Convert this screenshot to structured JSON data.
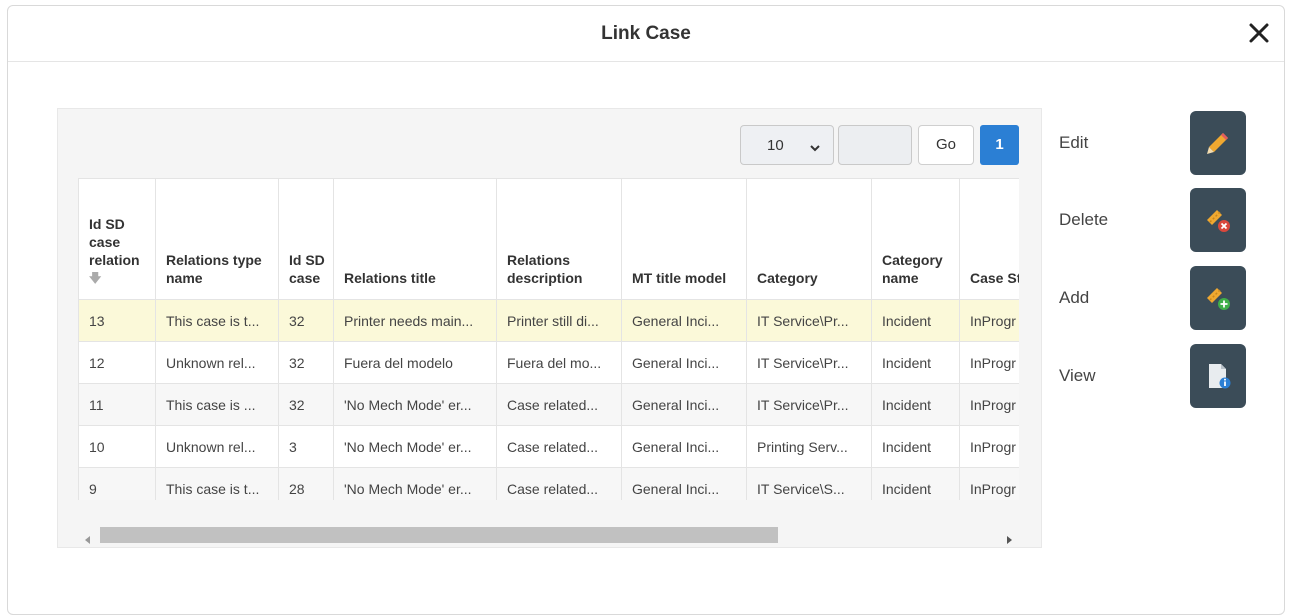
{
  "dialog": {
    "title": "Link Case"
  },
  "pager": {
    "page_size": "10",
    "page_input": "",
    "go_label": "Go",
    "current_page": "1"
  },
  "table": {
    "columns": [
      "Id SD case relation",
      "Relations type name",
      "Id SD case",
      "Relations title",
      "Relations description",
      "MT title model",
      "Category",
      "Category name",
      "Case Status"
    ],
    "rows": [
      [
        "13",
        "This case is t...",
        "32",
        "Printer needs main...",
        "Printer still di...",
        "General Inci...",
        "IT Service\\Pr...",
        "Incident",
        "InProgr"
      ],
      [
        "12",
        "Unknown rel...",
        "32",
        "Fuera del modelo",
        "Fuera del mo...",
        "General Inci...",
        "IT Service\\Pr...",
        "Incident",
        "InProgr"
      ],
      [
        "11",
        "This case is ...",
        "32",
        "'No Mech Mode' er...",
        "Case related...",
        "General Inci...",
        "IT Service\\Pr...",
        "Incident",
        "InProgr"
      ],
      [
        "10",
        "Unknown rel...",
        "3",
        "'No Mech Mode' er...",
        "Case related...",
        "General Inci...",
        "Printing Serv...",
        "Incident",
        "InProgr"
      ],
      [
        "9",
        "This case is t...",
        "28",
        "'No Mech Mode' er...",
        "Case related...",
        "General Inci...",
        "IT Service\\S...",
        "Incident",
        "InProgr"
      ]
    ]
  },
  "actions": {
    "edit_label": "Edit",
    "delete_label": "Delete",
    "add_label": "Add",
    "view_label": "View"
  },
  "colors": {
    "accent": "#2b7fd4",
    "action_button_bg": "#3b4c58",
    "selected_row": "#fbf9d9"
  }
}
